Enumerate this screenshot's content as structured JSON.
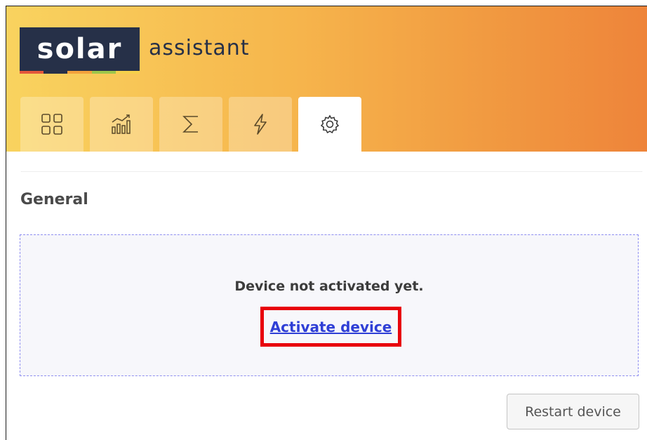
{
  "brand": {
    "logo_text": "solar",
    "subtitle": "assistant",
    "logo_bar_colors": [
      "#e4573b",
      "#263048",
      "#f3a13c",
      "#9cc64b",
      "#f5d04b"
    ]
  },
  "tabs": [
    {
      "icon": "dashboard-grid-icon",
      "active": false
    },
    {
      "icon": "charts-icon",
      "active": false
    },
    {
      "icon": "sigma-totals-icon",
      "active": false
    },
    {
      "icon": "lightning-power-icon",
      "active": false
    },
    {
      "icon": "gear-settings-icon",
      "active": true
    }
  ],
  "section": {
    "title": "General"
  },
  "activation": {
    "message": "Device not activated yet.",
    "link_label": "Activate device",
    "highlight_color": "#e8000b"
  },
  "actions": {
    "restart_label": "Restart device"
  },
  "colors": {
    "header_gradient_start": "#f9d35f",
    "header_gradient_end": "#ee843a",
    "link": "#2f3fd6",
    "logo_background": "#263048"
  }
}
